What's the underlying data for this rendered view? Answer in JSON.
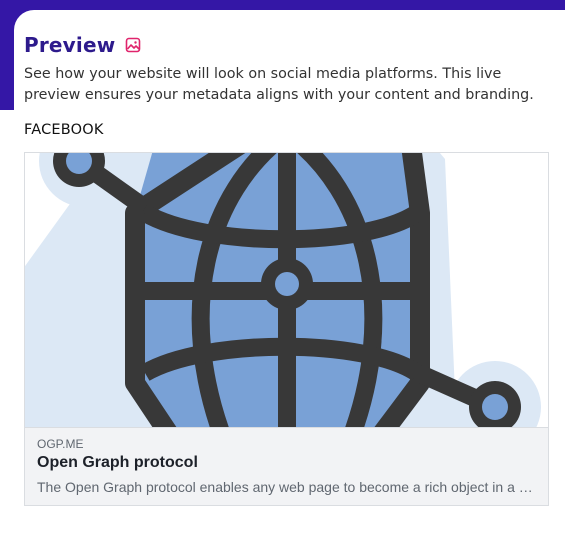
{
  "header": {
    "title": "Preview",
    "icon": "image-icon",
    "accent_color": "#2d1a8c",
    "icon_color": "#e0246c",
    "description": "See how your website will look on social media platforms. This live preview ensures your metadata aligns with your content and branding."
  },
  "facebook": {
    "section_label": "FACEBOOK",
    "image": "open-graph-logo",
    "domain": "OGP.ME",
    "title": "Open Graph protocol",
    "description": "The Open Graph protocol enables any web page to become a rich object in a social graph."
  }
}
